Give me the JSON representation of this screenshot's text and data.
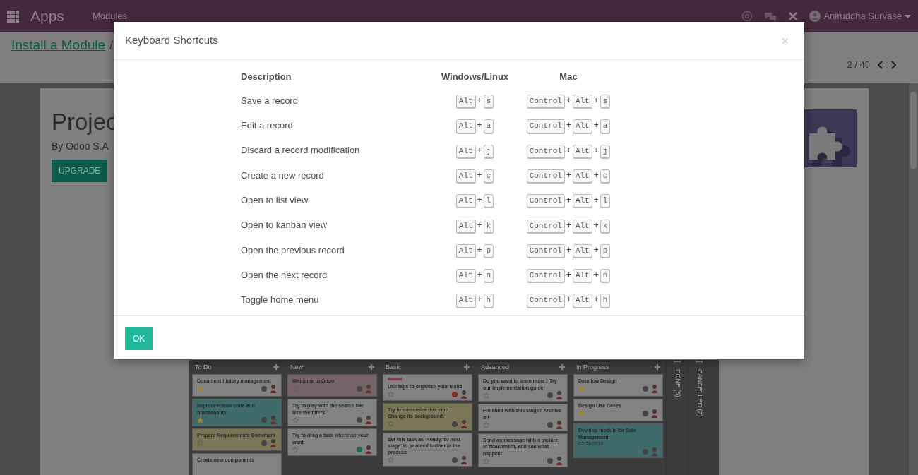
{
  "navbar": {
    "app_title": "Apps",
    "menu": [
      "Modules"
    ],
    "user": "Aniruddha Survase"
  },
  "control_panel": {
    "breadcrumb": [
      "Install a Module",
      "/"
    ],
    "pager": "2 / 40"
  },
  "module": {
    "title": "Projec",
    "author": "By Odoo S.A",
    "button": "UPGRADE",
    "screenshot": {
      "columns": [
        {
          "kind": "open",
          "title": "To Do",
          "cards": [
            {
              "title": "Document history management",
              "kind": "plain",
              "starred": true,
              "color": "#444444"
            },
            {
              "title": "Improve+clean code and functionality",
              "kind": "teal",
              "starred": true,
              "color": "#444444"
            },
            {
              "title": "Prepare Requirements Document",
              "kind": "yellow",
              "starred": false,
              "color": "#444444"
            },
            {
              "title": "Create new components",
              "kind": "plain"
            }
          ]
        },
        {
          "kind": "open",
          "title": "New",
          "cards": [
            {
              "title": "Welcome to Odoo",
              "kind": "pink",
              "starred": false,
              "color": "#444444"
            },
            {
              "title": "Try to play with the search bar. Use the filters",
              "kind": "plain",
              "starred": false,
              "color": "#444444"
            },
            {
              "title": "Try to drag a task wherever your want",
              "kind": "plain",
              "starred": false,
              "color": "#1f6a5a"
            }
          ]
        },
        {
          "kind": "open",
          "title": "Basic",
          "cards": [
            {
              "title": "Use tags to organize your tasks",
              "kind": "plain",
              "starred": false,
              "color": "#8a2a1e",
              "tag": {
                "color": "#8a3a5c"
              }
            },
            {
              "title": "Try to customize this card. Change its background.",
              "kind": "yellow",
              "starred": false,
              "color": "#444444"
            },
            {
              "title": "Set this task as 'Ready for next stage' to proceed further in the process",
              "kind": "plain",
              "starred": false,
              "color": "#444444"
            }
          ]
        },
        {
          "kind": "open",
          "title": "Advanced",
          "cards": [
            {
              "title": "Do you want to learn more? Try our implementation guide!",
              "kind": "plain",
              "starred": false,
              "color": "#444444"
            },
            {
              "title": "Finished with this stage? Archive it !",
              "kind": "plain",
              "starred": false,
              "color": "#444444"
            },
            {
              "title": "Send an message with a picture in attachment, and see what happen!",
              "kind": "plain",
              "starred": false,
              "color": "#444444"
            }
          ]
        },
        {
          "kind": "open",
          "title": "In Progress",
          "cards": [
            {
              "title": "Dataflow Design",
              "kind": "plain",
              "starred": true,
              "color": "#444444"
            },
            {
              "title": "Design Use Cases",
              "kind": "plain",
              "starred": true,
              "color": "#444444"
            },
            {
              "title": "Develop module for Sale Management",
              "date": "02/19/2016",
              "kind": "teal",
              "starred": false,
              "color": "#444444"
            }
          ]
        },
        {
          "kind": "folded",
          "title": "DONE (5)"
        },
        {
          "kind": "folded",
          "title": "CANCELLED (2)"
        }
      ]
    }
  },
  "dialog": {
    "title": "Keyboard Shortcuts",
    "close": "×",
    "columns": [
      "Description",
      "Windows/Linux",
      "Mac"
    ],
    "rows": [
      {
        "description": "Save a record",
        "windows": [
          "Alt",
          "+",
          "s"
        ],
        "mac": [
          "Control",
          "+",
          "Alt",
          "+",
          "s"
        ]
      },
      {
        "description": "Edit a record",
        "windows": [
          "Alt",
          "+",
          "a"
        ],
        "mac": [
          "Control",
          "+",
          "Alt",
          "+",
          "a"
        ]
      },
      {
        "description": "Discard a record modification",
        "windows": [
          "Alt",
          "+",
          "j"
        ],
        "mac": [
          "Control",
          "+",
          "Alt",
          "+",
          "j"
        ]
      },
      {
        "description": "Create a new record",
        "windows": [
          "Alt",
          "+",
          "c"
        ],
        "mac": [
          "Control",
          "+",
          "Alt",
          "+",
          "c"
        ]
      },
      {
        "description": "Open to list view",
        "windows": [
          "Alt",
          "+",
          "l"
        ],
        "mac": [
          "Control",
          "+",
          "Alt",
          "+",
          "l"
        ]
      },
      {
        "description": "Open to kanban view",
        "windows": [
          "Alt",
          "+",
          "k"
        ],
        "mac": [
          "Control",
          "+",
          "Alt",
          "+",
          "k"
        ]
      },
      {
        "description": "Open the previous record",
        "windows": [
          "Alt",
          "+",
          "p"
        ],
        "mac": [
          "Control",
          "+",
          "Alt",
          "+",
          "p"
        ]
      },
      {
        "description": "Open the next record",
        "windows": [
          "Alt",
          "+",
          "n"
        ],
        "mac": [
          "Control",
          "+",
          "Alt",
          "+",
          "n"
        ]
      },
      {
        "description": "Toggle home menu",
        "windows": [
          "Alt",
          "+",
          "h"
        ],
        "mac": [
          "Control",
          "+",
          "Alt",
          "+",
          "h"
        ]
      }
    ],
    "button": "OK"
  }
}
